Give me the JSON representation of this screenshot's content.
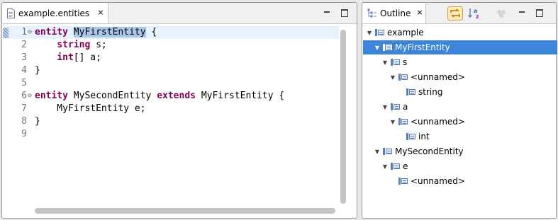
{
  "editor": {
    "tab_label": "example.entities",
    "lines": [
      {
        "num": "1",
        "fold": "⊖",
        "tokens": [
          {
            "t": "entity",
            "k": "kw"
          },
          {
            "t": " "
          },
          {
            "t": "MyFirstEntity",
            "k": "sel"
          },
          {
            "t": " {"
          }
        ]
      },
      {
        "num": "2",
        "fold": "",
        "tokens": [
          {
            "t": "    "
          },
          {
            "t": "string",
            "k": "kw"
          },
          {
            "t": " s;"
          }
        ]
      },
      {
        "num": "3",
        "fold": "",
        "tokens": [
          {
            "t": "    "
          },
          {
            "t": "int",
            "k": "kw"
          },
          {
            "t": "[] a;"
          }
        ]
      },
      {
        "num": "4",
        "fold": "",
        "tokens": [
          {
            "t": "}"
          }
        ]
      },
      {
        "num": "5",
        "fold": "",
        "tokens": []
      },
      {
        "num": "6",
        "fold": "⊖",
        "tokens": [
          {
            "t": "entity",
            "k": "kw"
          },
          {
            "t": " MySecondEntity "
          },
          {
            "t": "extends",
            "k": "kw"
          },
          {
            "t": " MyFirstEntity {"
          }
        ]
      },
      {
        "num": "7",
        "fold": "",
        "tokens": [
          {
            "t": "    MyFirstEntity e;"
          }
        ]
      },
      {
        "num": "8",
        "fold": "",
        "tokens": [
          {
            "t": "}"
          }
        ]
      },
      {
        "num": "9",
        "fold": "",
        "tokens": []
      }
    ]
  },
  "outline": {
    "tab_label": "Outline",
    "tree": [
      {
        "label": "example",
        "depth": 0,
        "expanded": true,
        "selected": false
      },
      {
        "label": "MyFirstEntity",
        "depth": 1,
        "expanded": true,
        "selected": true
      },
      {
        "label": "s",
        "depth": 2,
        "expanded": true,
        "selected": false
      },
      {
        "label": "<unnamed>",
        "depth": 3,
        "expanded": true,
        "selected": false
      },
      {
        "label": "string",
        "depth": 4,
        "expanded": false,
        "selected": false
      },
      {
        "label": "a",
        "depth": 2,
        "expanded": true,
        "selected": false
      },
      {
        "label": "<unnamed>",
        "depth": 3,
        "expanded": true,
        "selected": false
      },
      {
        "label": "int",
        "depth": 4,
        "expanded": false,
        "selected": false
      },
      {
        "label": "MySecondEntity",
        "depth": 1,
        "expanded": true,
        "selected": false
      },
      {
        "label": "e",
        "depth": 2,
        "expanded": true,
        "selected": false
      },
      {
        "label": "<unnamed>",
        "depth": 3,
        "expanded": false,
        "selected": false
      }
    ]
  },
  "colors": {
    "keyword": "#7f0055",
    "selection": "#3d85d8",
    "current_line": "#e8f2fe"
  }
}
